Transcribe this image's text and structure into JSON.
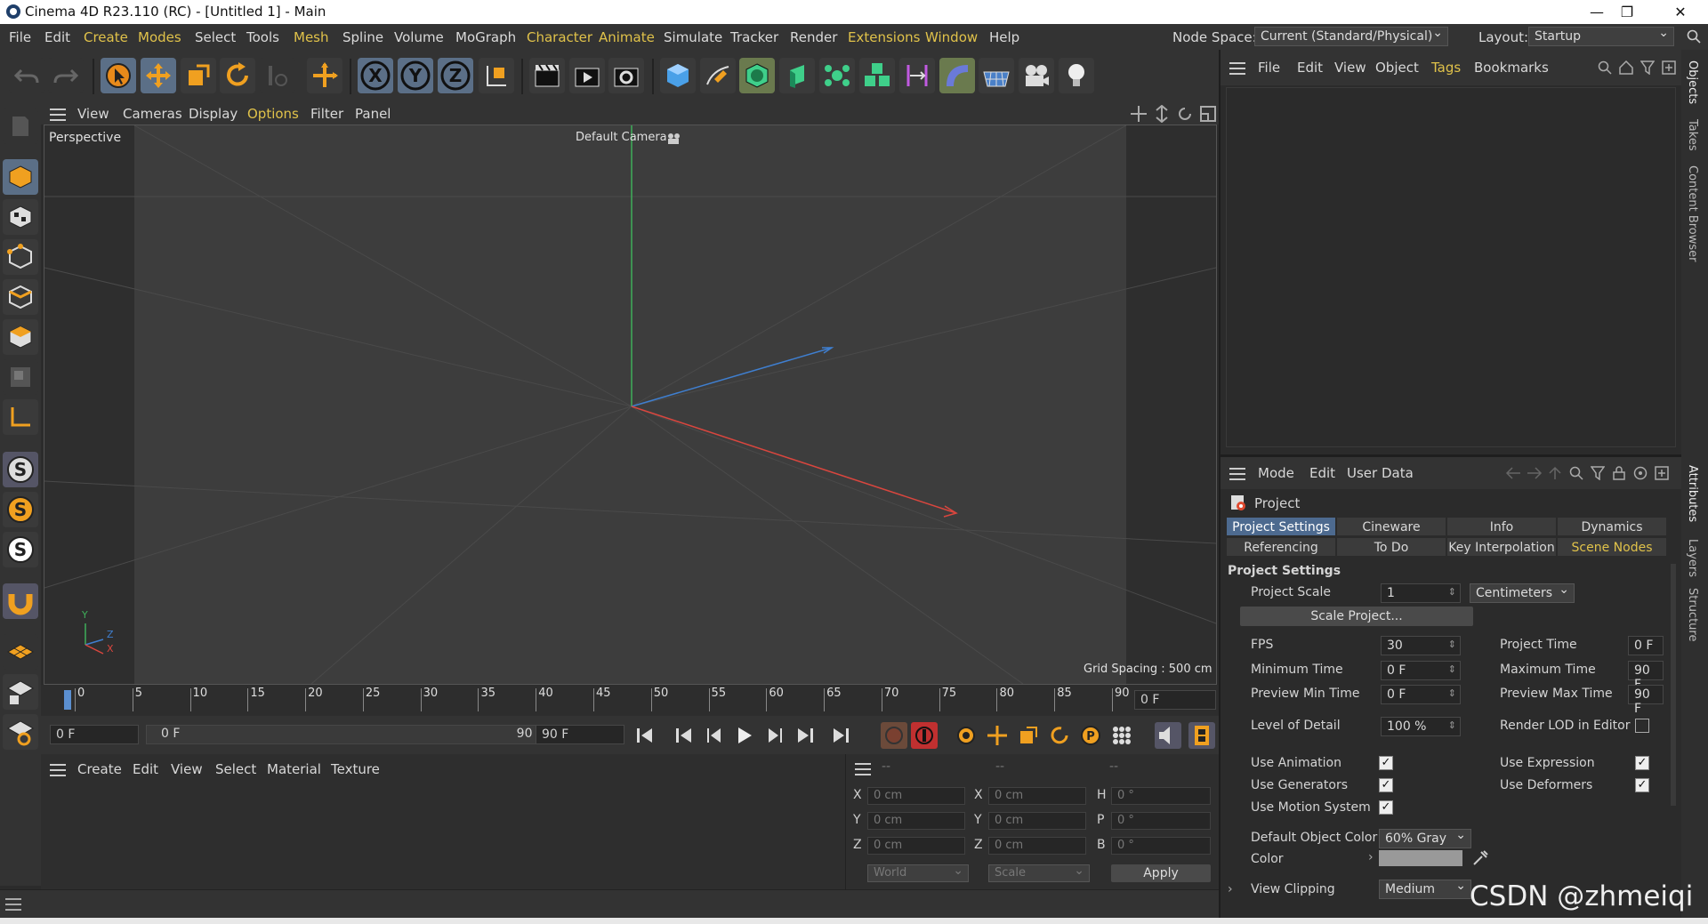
{
  "window": {
    "title": "Cinema 4D R23.110 (RC) - [Untitled 1] - Main",
    "controls": [
      "—",
      "❐",
      "✕"
    ]
  },
  "menubar": {
    "items": [
      "File",
      "Edit",
      "Create",
      "Modes",
      "Select",
      "Tools",
      "Mesh",
      "Spline",
      "Volume",
      "MoGraph",
      "Character",
      "Animate",
      "Simulate",
      "Tracker",
      "Render",
      "Extensions",
      "Window",
      "Help"
    ],
    "node_space_label": "Node Space:",
    "node_space_value": "Current (Standard/Physical)",
    "layout_label": "Layout:",
    "layout_value": "Startup"
  },
  "viewport": {
    "menu": [
      "View",
      "Cameras",
      "Display",
      "Options",
      "Filter",
      "Panel"
    ],
    "view_name": "Perspective",
    "camera": "Default Camera",
    "grid_spacing": "Grid Spacing : 500 cm",
    "axis_labels": {
      "y": "Y",
      "z": "Z",
      "x": "X"
    }
  },
  "timeline": {
    "ticks": [
      "0",
      "5",
      "10",
      "15",
      "20",
      "25",
      "30",
      "35",
      "40",
      "45",
      "50",
      "55",
      "60",
      "65",
      "70",
      "75",
      "80",
      "85",
      "90"
    ],
    "current_frame": "0 F"
  },
  "transport": {
    "start_field": "0 F",
    "range_start": "0 F",
    "range_end": "90 F",
    "end_field": "90 F"
  },
  "material_panel": {
    "menu": [
      "Create",
      "Edit",
      "View",
      "Select",
      "Material",
      "Texture"
    ]
  },
  "coord_panel": {
    "headers": [
      "--",
      "--",
      "--"
    ],
    "rows": [
      {
        "l1": "X",
        "v1": "0 cm",
        "l2": "X",
        "v2": "0 cm",
        "l3": "H",
        "v3": "0 °"
      },
      {
        "l1": "Y",
        "v1": "0 cm",
        "l2": "Y",
        "v2": "0 cm",
        "l3": "P",
        "v3": "0 °"
      },
      {
        "l1": "Z",
        "v1": "0 cm",
        "l2": "Z",
        "v2": "0 cm",
        "l3": "B",
        "v3": "0 °"
      }
    ],
    "world": "World",
    "scale": "Scale",
    "apply": "Apply"
  },
  "object_panel": {
    "menu": [
      "File",
      "Edit",
      "View",
      "Object",
      "Tags",
      "Bookmarks"
    ]
  },
  "right_rail": [
    "Objects",
    "Takes",
    "Content Browser",
    "Attributes",
    "Layers",
    "Structure"
  ],
  "attributes": {
    "menu": [
      "Mode",
      "Edit",
      "User Data"
    ],
    "object_name": "Project",
    "tabs_row1": [
      "Project Settings",
      "Cineware",
      "Info",
      "Dynamics"
    ],
    "tabs_row2": [
      "Referencing",
      "To Do",
      "Key Interpolation",
      "Scene Nodes"
    ],
    "section": "Project Settings",
    "project_scale_label": "Project Scale",
    "project_scale_value": "1",
    "project_scale_unit": "Centimeters",
    "scale_project_button": "Scale Project...",
    "fps_label": "FPS",
    "fps_value": "30",
    "project_time_label": "Project Time",
    "project_time_value": "0 F",
    "min_time_label": "Minimum Time",
    "min_time_value": "0 F",
    "max_time_label": "Maximum Time",
    "max_time_value": "90 F",
    "preview_min_label": "Preview Min Time",
    "preview_min_value": "0 F",
    "preview_max_label": "Preview Max Time",
    "preview_max_value": "90 F",
    "lod_label": "Level of Detail",
    "lod_value": "100 %",
    "render_lod_label": "Render LOD in Editor",
    "use_animation_label": "Use Animation",
    "use_expression_label": "Use Expression",
    "use_generators_label": "Use Generators",
    "use_deformers_label": "Use Deformers",
    "use_motion_label": "Use Motion System",
    "default_color_label": "Default Object Color",
    "default_color_value": "60% Gray",
    "color_label": "Color",
    "view_clipping_label": "View Clipping",
    "view_clipping_value": "Medium",
    "checkbox_on": "✓"
  },
  "watermark": "CSDN @zhmeiqi",
  "colors": {
    "accent": "#e0c24a",
    "selected_tab": "#4d6a8f",
    "x_axis": "#d9463e",
    "y_axis": "#3fae5a",
    "z_axis": "#3f7fd0"
  }
}
